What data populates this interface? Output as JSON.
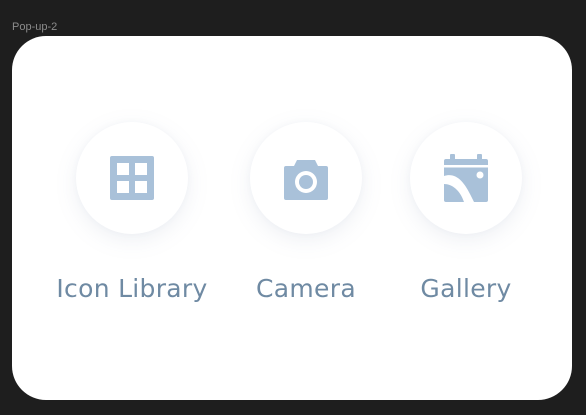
{
  "frame": {
    "label": "Pop-up-2"
  },
  "options": [
    {
      "label": "Icon Library",
      "icon": "grid-icon"
    },
    {
      "label": "Camera",
      "icon": "camera-icon"
    },
    {
      "label": "Gallery",
      "icon": "gallery-icon"
    }
  ],
  "colors": {
    "background": "#1e1e1e",
    "popup": "#ffffff",
    "icon": "#a9c1d9",
    "label": "#6f8aa3"
  }
}
